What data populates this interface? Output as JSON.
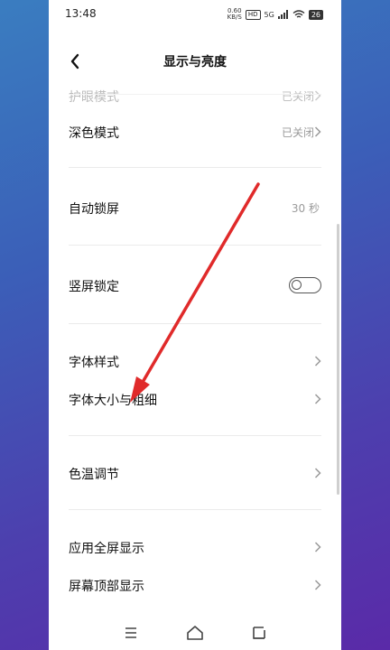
{
  "status_bar": {
    "time": "13:48",
    "speed_top": "0.60",
    "speed_bottom": "KB/S",
    "hd_badge": "HD",
    "network": "5G",
    "battery": "26"
  },
  "header": {
    "title": "显示与亮度",
    "back_icon": "chevron-left-icon"
  },
  "settings": {
    "eye_protection": {
      "label": "护眼模式",
      "value": "已关闭"
    },
    "dark_mode": {
      "label": "深色模式",
      "value": "已关闭"
    },
    "auto_lock": {
      "label": "自动锁屏",
      "value": "30 秒"
    },
    "portrait_lock": {
      "label": "竖屏锁定",
      "enabled": false
    },
    "font_style": {
      "label": "字体样式"
    },
    "font_size_weight": {
      "label": "字体大小与粗细"
    },
    "color_temperature": {
      "label": "色温调节"
    },
    "app_fullscreen": {
      "label": "应用全屏显示"
    },
    "screen_top_display": {
      "label": "屏幕顶部显示"
    }
  },
  "nav_bar": {
    "menu_icon": "menu-icon",
    "home_icon": "home-icon",
    "back_icon": "back-icon"
  },
  "colors": {
    "annotation_arrow": "#e02a2a",
    "toggle_off": "#555555"
  }
}
